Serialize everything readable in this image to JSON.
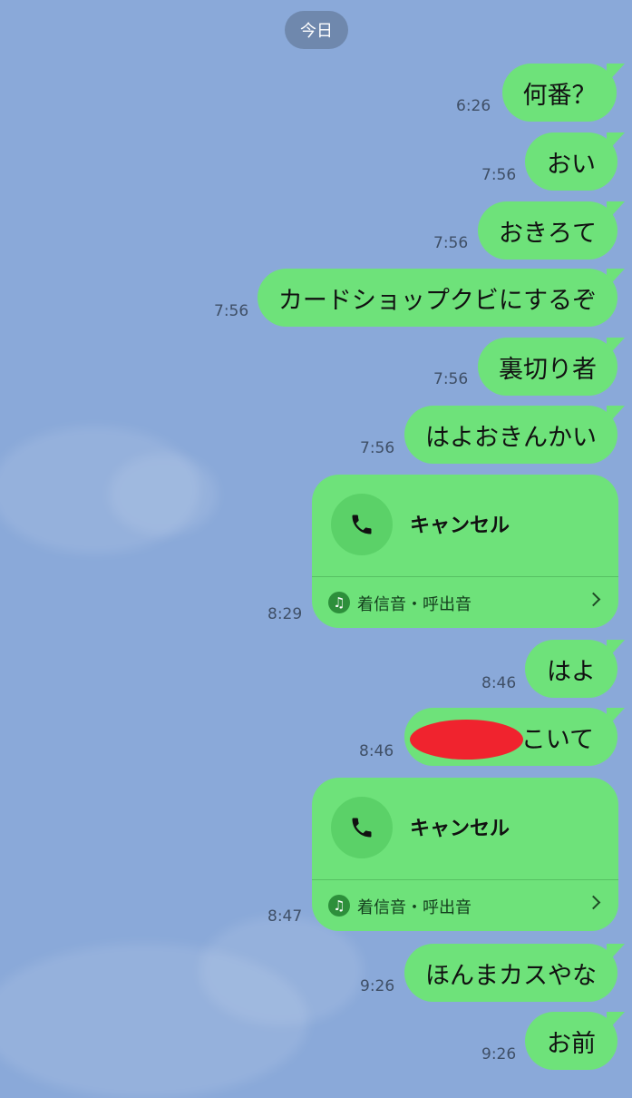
{
  "date_header": "今日",
  "messages": [
    {
      "text": "何番？",
      "time": "6:26"
    },
    {
      "text": "おい",
      "time": "7:56"
    },
    {
      "text": "おきろて",
      "time": "7:56"
    },
    {
      "text": "カードショップクビにするぞ",
      "time": "7:56"
    },
    {
      "text": "裏切り者",
      "time": "7:56"
    },
    {
      "text": "はよおきんかい",
      "time": "7:56"
    },
    {
      "text": "はよ",
      "time": "8:46"
    },
    {
      "text": "こいて",
      "time": "8:46"
    },
    {
      "text": "ほんまカスやな",
      "time": "9:26"
    },
    {
      "text": "お前",
      "time": "9:26"
    }
  ],
  "calls": [
    {
      "title": "キャンセル",
      "ringtone_label": "着信音・呼出音",
      "time": "8:29"
    },
    {
      "title": "キャンセル",
      "ringtone_label": "着信音・呼出音",
      "time": "8:47"
    }
  ],
  "colors": {
    "background": "#8aa9d9",
    "bubble": "#6ee27a",
    "redaction": "#f0232e"
  },
  "icons": {
    "call": "phone-icon",
    "ringtone": "music-note-icon",
    "more": "chevron-right-icon"
  }
}
